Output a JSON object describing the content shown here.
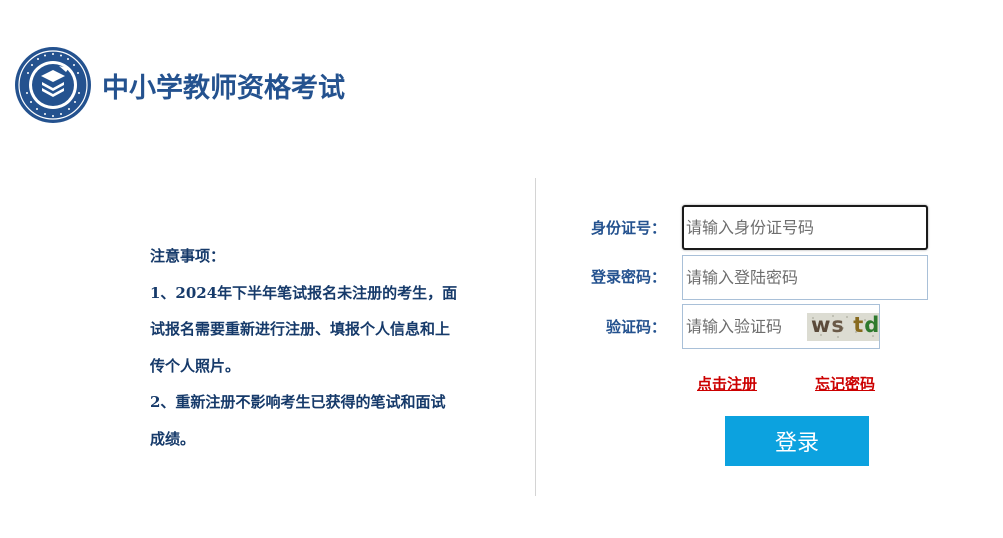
{
  "header": {
    "logo_title": "中小学教师资格考试",
    "logo_icon": "teacher-certification-emblem"
  },
  "notice": {
    "heading": "注意事项：",
    "item1_line1": "1、2024年下半年笔试报名未注册的考生，面",
    "item1_line2": "试报名需要重新进行注册、填报个人信息和上",
    "item1_line3": "传个人照片。",
    "item2_line1": "2、重新注册不影响考生已获得的笔试和面试",
    "item2_line2": "成绩。"
  },
  "form": {
    "id_label": "身份证号：",
    "id_placeholder": "请输入身份证号码",
    "id_value": "",
    "password_label": "登录密码：",
    "password_placeholder": "请输入登陆密码",
    "password_value": "",
    "captcha_label": "验证码：",
    "captcha_placeholder": "请输入验证码",
    "captcha_value": "",
    "captcha_chars": [
      "w",
      "s",
      "t",
      "d"
    ]
  },
  "links": {
    "register": "点击注册",
    "forgot_password": "忘记密码"
  },
  "login_button": "登录",
  "colors": {
    "brand_blue": "#24528f",
    "notice_text": "#163a6a",
    "link_red": "#cc0000",
    "button_blue": "#0ca2df"
  }
}
